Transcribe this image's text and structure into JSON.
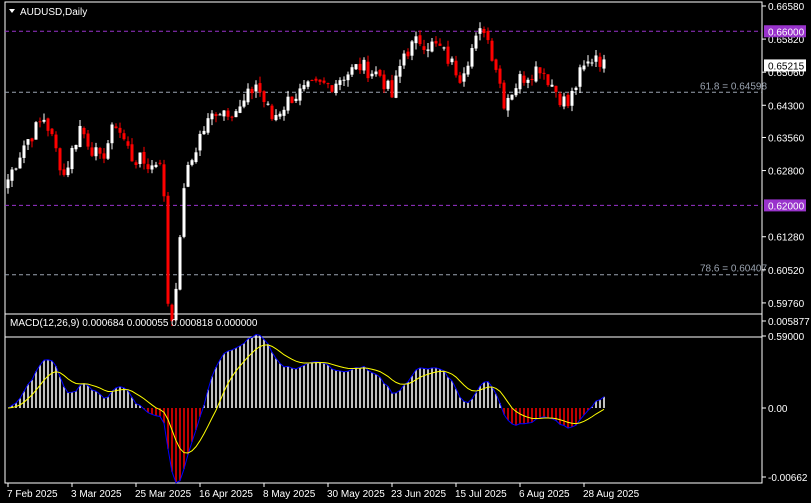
{
  "header": {
    "symbol_label": "AUDUSD,Daily"
  },
  "colors": {
    "bull": "#ffffff",
    "bear": "#ff0000",
    "macd_line": "#0000ff",
    "signal_line": "#ffff00",
    "level": "#9933cc",
    "fib": "#9aa3b0"
  },
  "chart_data": [
    {
      "type": "candlestick",
      "title": "AUDUSD,Daily",
      "ylim": [
        0.59,
        0.6658
      ],
      "y_ticks": [
        "0.66580",
        "0.65820",
        "0.65060",
        "0.64300",
        "0.63560",
        "0.62800",
        "0.61280",
        "0.60520",
        "0.59760",
        "0.59000"
      ],
      "x_ticks": [
        "7 Feb 2025",
        "3 Mar 2025",
        "25 Mar 2025",
        "16 Apr 2025",
        "8 May 2025",
        "30 May 2025",
        "23 Jun 2025",
        "15 Jul 2025",
        "6 Aug 2025",
        "28 Aug 2025"
      ],
      "close_anchors": [
        [
          0,
          0.626
        ],
        [
          4,
          0.634
        ],
        [
          9,
          0.64
        ],
        [
          10,
          0.638
        ],
        [
          14,
          0.627
        ],
        [
          18,
          0.638
        ],
        [
          23,
          0.63
        ],
        [
          27,
          0.639
        ],
        [
          31,
          0.631
        ],
        [
          36,
          0.629
        ],
        [
          38,
          0.631
        ],
        [
          39,
          0.621
        ],
        [
          40,
          0.598
        ],
        [
          41,
          0.594
        ],
        [
          43,
          0.611
        ],
        [
          44,
          0.625
        ],
        [
          48,
          0.636
        ],
        [
          52,
          0.642
        ],
        [
          58,
          0.642
        ],
        [
          62,
          0.648
        ],
        [
          66,
          0.64
        ],
        [
          71,
          0.645
        ],
        [
          76,
          0.647
        ],
        [
          81,
          0.648
        ],
        [
          84,
          0.65
        ],
        [
          88,
          0.652
        ],
        [
          93,
          0.65
        ],
        [
          96,
          0.645
        ],
        [
          99,
          0.655
        ],
        [
          103,
          0.658
        ],
        [
          108,
          0.656
        ],
        [
          113,
          0.65
        ],
        [
          116,
          0.656
        ],
        [
          119,
          0.661
        ],
        [
          122,
          0.652
        ],
        [
          124,
          0.644
        ],
        [
          128,
          0.649
        ],
        [
          133,
          0.652
        ],
        [
          138,
          0.645
        ],
        [
          140,
          0.643
        ],
        [
          143,
          0.65
        ],
        [
          147,
          0.655
        ],
        [
          149,
          0.652
        ]
      ],
      "levels": [
        {
          "label": "0.66000",
          "value": 0.66,
          "style": "level"
        },
        {
          "label": "0.62000",
          "value": 0.62,
          "style": "level"
        },
        {
          "label": "61.8 = 0.64598",
          "value": 0.64598,
          "style": "fib"
        },
        {
          "label": "78.6 = 0.60407",
          "value": 0.60407,
          "style": "fib"
        }
      ],
      "current_price": {
        "label": "0.65215",
        "value": 0.65215
      }
    },
    {
      "type": "macd",
      "label": "MACD(12,26,9) 0.000684 0.000055 0.000818 0.000000",
      "ylim": [
        -0.00662,
        0.005877
      ],
      "y_ticks": [
        "0.005877",
        "0.00",
        "-0.00662"
      ]
    }
  ]
}
